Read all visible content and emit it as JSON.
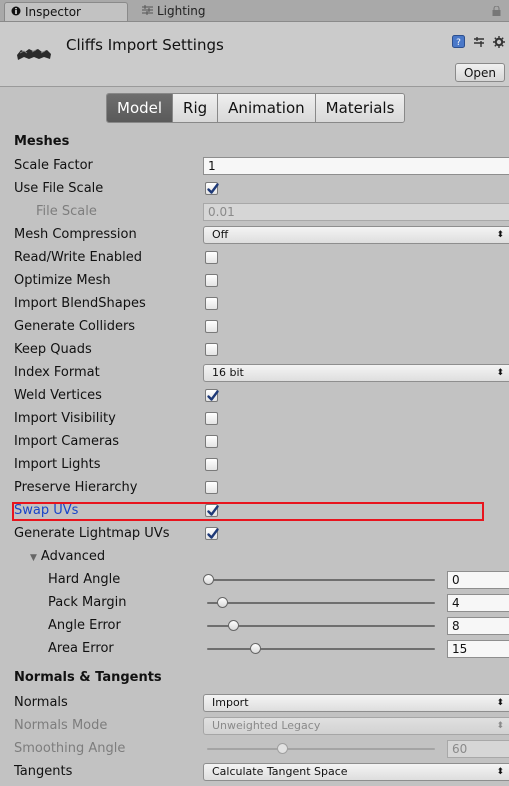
{
  "tabs": {
    "inspector": "Inspector",
    "lighting": "Lighting"
  },
  "header": {
    "title": "Cliffs Import Settings",
    "open_label": "Open"
  },
  "toolbar": {
    "model": "Model",
    "rig": "Rig",
    "animation": "Animation",
    "materials": "Materials",
    "active": "Model"
  },
  "meshes": {
    "section": "Meshes",
    "scale_factor_label": "Scale Factor",
    "scale_factor_value": "1",
    "use_file_scale_label": "Use File Scale",
    "use_file_scale_checked": true,
    "file_scale_label": "File Scale",
    "file_scale_value": "0.01",
    "mesh_compression_label": "Mesh Compression",
    "mesh_compression_value": "Off",
    "read_write_label": "Read/Write Enabled",
    "read_write_checked": false,
    "optimize_mesh_label": "Optimize Mesh",
    "optimize_mesh_checked": false,
    "import_blendshapes_label": "Import BlendShapes",
    "import_blendshapes_checked": false,
    "generate_colliders_label": "Generate Colliders",
    "generate_colliders_checked": false,
    "keep_quads_label": "Keep Quads",
    "keep_quads_checked": false,
    "index_format_label": "Index Format",
    "index_format_value": "16 bit",
    "weld_vertices_label": "Weld Vertices",
    "weld_vertices_checked": true,
    "import_visibility_label": "Import Visibility",
    "import_visibility_checked": false,
    "import_cameras_label": "Import Cameras",
    "import_cameras_checked": false,
    "import_lights_label": "Import Lights",
    "import_lights_checked": false,
    "preserve_hierarchy_label": "Preserve Hierarchy",
    "preserve_hierarchy_checked": false,
    "swap_uvs_label": "Swap UVs",
    "swap_uvs_checked": true,
    "generate_lightmap_label": "Generate Lightmap UVs",
    "generate_lightmap_checked": true
  },
  "advanced": {
    "label": "Advanced",
    "hard_angle_label": "Hard Angle",
    "hard_angle_value": "0",
    "hard_angle_fraction": 0.0,
    "pack_margin_label": "Pack Margin",
    "pack_margin_value": "4",
    "pack_margin_fraction": 0.06,
    "angle_error_label": "Angle Error",
    "angle_error_value": "8",
    "angle_error_fraction": 0.11,
    "area_error_label": "Area Error",
    "area_error_value": "15",
    "area_error_fraction": 0.21
  },
  "normals": {
    "section": "Normals & Tangents",
    "normals_label": "Normals",
    "normals_value": "Import",
    "normals_mode_label": "Normals Mode",
    "normals_mode_value": "Unweighted Legacy",
    "smoothing_angle_label": "Smoothing Angle",
    "smoothing_angle_value": "60",
    "smoothing_angle_fraction": 0.33,
    "tangents_label": "Tangents",
    "tangents_value": "Calculate Tangent Space"
  },
  "colors": {
    "highlight": "#e8141d",
    "checkmark": "#1f3a78",
    "active_tab": "#5f5f5f"
  }
}
